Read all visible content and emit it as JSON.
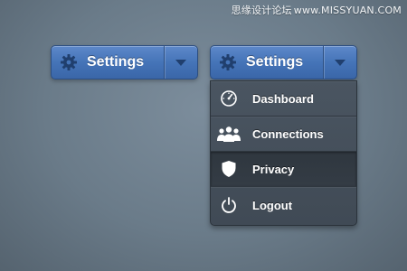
{
  "watermark": {
    "part1": "思缘设计论坛",
    "separator": "www.MISSYUAN.COM"
  },
  "left_button": {
    "label": "Settings",
    "icon": "gear-icon",
    "dropdown_icon": "caret-down-icon"
  },
  "right_button": {
    "label": "Settings",
    "icon": "gear-icon",
    "dropdown_icon": "caret-down-icon",
    "expanded": true
  },
  "menu": {
    "items": [
      {
        "label": "Dashboard",
        "icon": "speedometer-icon"
      },
      {
        "label": "Connections",
        "icon": "people-icon"
      },
      {
        "label": "Privacy",
        "icon": "shield-icon",
        "active": true
      },
      {
        "label": "Logout",
        "icon": "power-icon"
      }
    ]
  },
  "colors": {
    "accent": "#4574b8",
    "menu_bg": "#444f5a",
    "background": "#6f808e"
  }
}
